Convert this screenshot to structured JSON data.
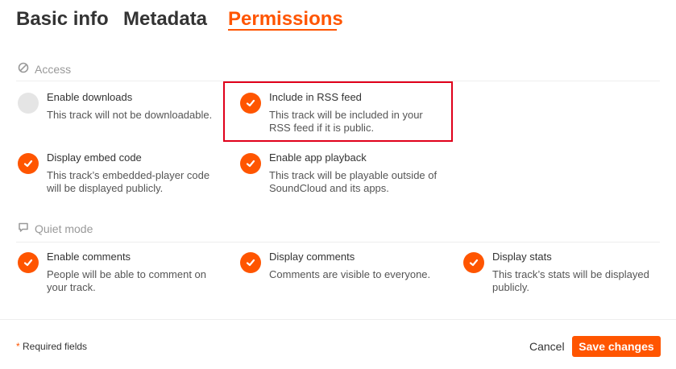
{
  "tabs": [
    {
      "label": "Basic info"
    },
    {
      "label": "Metadata"
    },
    {
      "label": "Permissions"
    }
  ],
  "active_tab": "Permissions",
  "accent_color": "#ff5500",
  "highlight_color": "#e0001a",
  "sections": {
    "access": {
      "title": "Access",
      "icon": "prohibited-icon",
      "options": [
        {
          "title": "Enable downloads",
          "desc": "This track will not be downloadable.",
          "checked": false
        },
        {
          "title": "Include in RSS feed",
          "desc": "This track will be included in your RSS feed if it is public.",
          "checked": true
        },
        {
          "title": "Display embed code",
          "desc": "This track’s embedded-player code will be displayed publicly.",
          "checked": true
        },
        {
          "title": "Enable app playback",
          "desc": "This track will be playable outside of SoundCloud and its apps.",
          "checked": true
        }
      ]
    },
    "quiet": {
      "title": "Quiet mode",
      "icon": "speech-bubble-icon",
      "options": [
        {
          "title": "Enable comments",
          "desc": "People will be able to comment on your track.",
          "checked": true
        },
        {
          "title": "Display comments",
          "desc": "Comments are visible to everyone.",
          "checked": true
        },
        {
          "title": "Display stats",
          "desc": "This track’s stats will be displayed publicly.",
          "checked": true
        }
      ]
    }
  },
  "footer": {
    "required_star": "*",
    "required_label": "Required fields",
    "cancel_label": "Cancel",
    "save_label": "Save changes"
  }
}
